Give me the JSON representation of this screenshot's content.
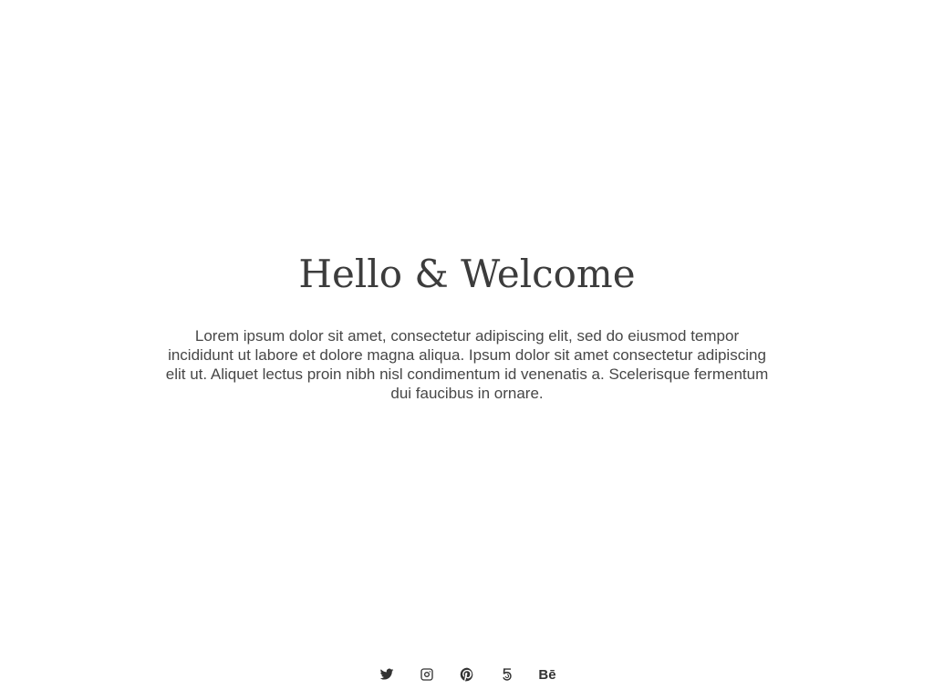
{
  "hero": {
    "title": "Hello & Welcome",
    "text": "Lorem ipsum dolor sit amet, consectetur adipiscing elit, sed do eiusmod tempor incididunt ut labore et dolore magna aliqua. Ipsum dolor sit amet consectetur adipiscing elit ut. Aliquet lectus proin nibh nisl condimentum id venenatis a. Scelerisque fermentum dui faucibus in ornare."
  },
  "social": {
    "items": [
      {
        "icon": "twitter-icon"
      },
      {
        "icon": "instagram-icon"
      },
      {
        "icon": "pinterest-icon"
      },
      {
        "icon": "500px-icon"
      },
      {
        "icon": "behance-icon",
        "glyph": "Bē"
      }
    ]
  },
  "colors": {
    "background": "#ffffff",
    "text": "#474747",
    "heading": "#3c3c3c",
    "icon": "#333333"
  }
}
